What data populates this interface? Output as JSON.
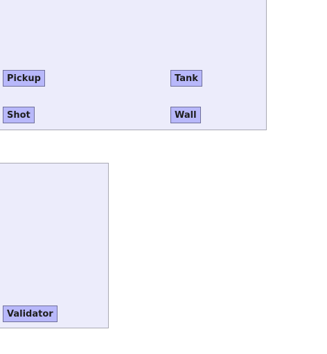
{
  "packages": [
    {
      "classes": [
        {
          "label": "Pickup"
        },
        {
          "label": "Tank"
        },
        {
          "label": "Shot"
        },
        {
          "label": "Wall"
        }
      ]
    },
    {
      "classes": [
        {
          "label": "Validator"
        }
      ]
    }
  ],
  "colors": {
    "package_fill": "#ececfb",
    "package_border": "#a9a9b3",
    "class_fill": "#b8b8fa",
    "class_border": "#6f6f9a"
  }
}
